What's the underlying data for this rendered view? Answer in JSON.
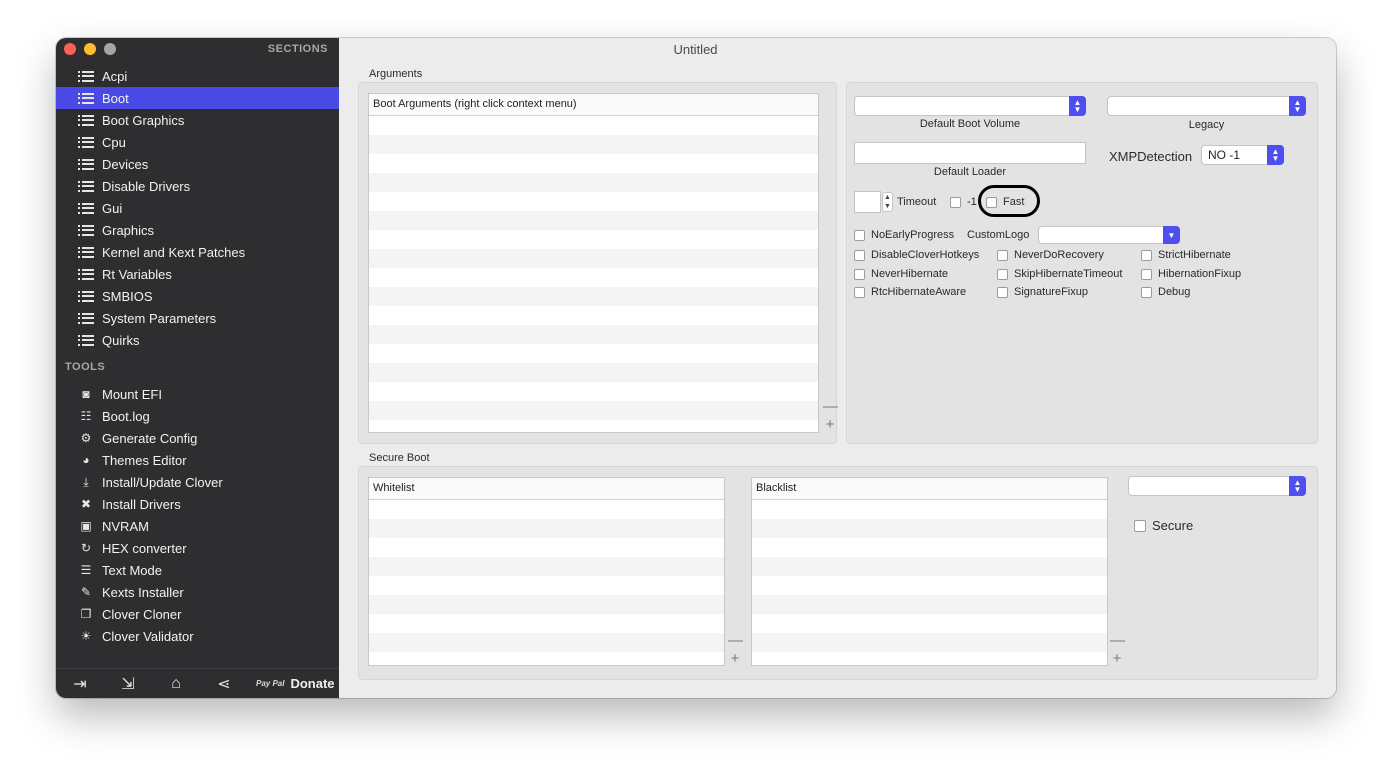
{
  "window": {
    "title": "Untitled"
  },
  "sidebar": {
    "sections_title": "SECTIONS",
    "sections": [
      {
        "label": "Acpi",
        "active": false
      },
      {
        "label": "Boot",
        "active": true
      },
      {
        "label": "Boot Graphics",
        "active": false
      },
      {
        "label": "Cpu",
        "active": false
      },
      {
        "label": "Devices",
        "active": false
      },
      {
        "label": "Disable Drivers",
        "active": false
      },
      {
        "label": "Gui",
        "active": false
      },
      {
        "label": "Graphics",
        "active": false
      },
      {
        "label": "Kernel and Kext Patches",
        "active": false
      },
      {
        "label": "Rt Variables",
        "active": false
      },
      {
        "label": "SMBIOS",
        "active": false
      },
      {
        "label": "System Parameters",
        "active": false
      },
      {
        "label": "Quirks",
        "active": false
      }
    ],
    "tools_title": "TOOLS",
    "tools": [
      {
        "label": "Mount EFI",
        "icon": "disk-icon",
        "glyph": "◙"
      },
      {
        "label": "Boot.log",
        "icon": "log-search-icon",
        "glyph": "☷"
      },
      {
        "label": "Generate Config",
        "icon": "gears-icon",
        "glyph": "⚙"
      },
      {
        "label": "Themes Editor",
        "icon": "palette-icon",
        "glyph": "◕"
      },
      {
        "label": "Install/Update Clover",
        "icon": "download-icon",
        "glyph": "⤓"
      },
      {
        "label": "Install Drivers",
        "icon": "tools-icon",
        "glyph": "✖"
      },
      {
        "label": "NVRAM",
        "icon": "chip-icon",
        "glyph": "▣"
      },
      {
        "label": "HEX converter",
        "icon": "refresh-icon",
        "glyph": "↻"
      },
      {
        "label": "Text Mode",
        "icon": "text-lines-icon",
        "glyph": "☰"
      },
      {
        "label": "Kexts Installer",
        "icon": "plug-icon",
        "glyph": "✎"
      },
      {
        "label": "Clover Cloner",
        "icon": "copy-icon",
        "glyph": "❐"
      },
      {
        "label": "Clover Validator",
        "icon": "lightbulb-icon",
        "glyph": "☀"
      }
    ],
    "bottom": {
      "donate_label": "Donate",
      "paypal_text": "Pay Pal"
    }
  },
  "arguments": {
    "group_title": "Arguments",
    "table_header": "Boot Arguments (right click context menu)",
    "rows": 16
  },
  "boot_options": {
    "default_boot_volume_label": "Default Boot Volume",
    "default_boot_volume_value": "",
    "legacy_label": "Legacy",
    "legacy_value": "",
    "default_loader_label": "Default Loader",
    "default_loader_value": "",
    "xmp_label": "XMPDetection",
    "xmp_value": "NO -1",
    "timeout_label": "Timeout",
    "timeout_value": "",
    "minus1_label": "-1",
    "fast_label": "Fast",
    "custom_logo_label": "CustomLogo",
    "custom_logo_value": "",
    "checkboxes": {
      "no_early_progress": "NoEarlyProgress",
      "disable_clover_hotkeys": "DisableCloverHotkeys",
      "never_do_recovery": "NeverDoRecovery",
      "strict_hibernate": "StrictHibernate",
      "never_hibernate": "NeverHibernate",
      "skip_hibernate_timeout": "SkipHibernateTimeout",
      "hibernation_fixup": "HibernationFixup",
      "rtc_hibernate_aware": "RtcHibernateAware",
      "signature_fixup": "SignatureFixup",
      "debug": "Debug"
    }
  },
  "secure_boot": {
    "group_title": "Secure Boot",
    "whitelist_header": "Whitelist",
    "blacklist_header": "Blacklist",
    "policy_value": "",
    "secure_label": "Secure",
    "rows": 9
  },
  "colors": {
    "accent": "#4949e6",
    "sidebar_bg": "#2e2e30",
    "annotation_ring": "#000000"
  }
}
